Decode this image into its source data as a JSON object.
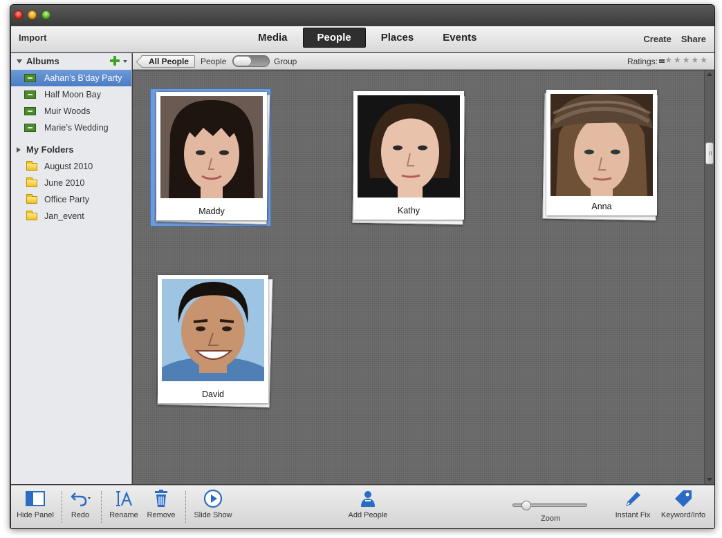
{
  "topbar": {
    "import_label": "Import",
    "tabs": [
      {
        "label": "Media",
        "active": false
      },
      {
        "label": "People",
        "active": true
      },
      {
        "label": "Places",
        "active": false
      },
      {
        "label": "Events",
        "active": false
      }
    ],
    "create_label": "Create",
    "share_label": "Share"
  },
  "sidebar": {
    "albums_heading": "Albums",
    "albums": [
      {
        "label": "Aahan’s B’day Party",
        "selected": true
      },
      {
        "label": "Half Moon Bay",
        "selected": false
      },
      {
        "label": "Muir Woods",
        "selected": false
      },
      {
        "label": "Marie’s Wedding",
        "selected": false
      }
    ],
    "folders_heading": "My Folders",
    "folders": [
      {
        "label": "August 2010"
      },
      {
        "label": "June 2010"
      },
      {
        "label": "Office Party"
      },
      {
        "label": "Jan_event"
      }
    ]
  },
  "filterbar": {
    "all_people_label": "All People",
    "people_label": "People",
    "group_label": "Group",
    "ratings_label": "Ratings:",
    "stars": "★★★★★"
  },
  "people": [
    {
      "name": "Maddy",
      "selected": true,
      "hair_color": "#1e1410",
      "skin_color": "#e3b8a0",
      "bg_color": "#6b5a52"
    },
    {
      "name": "Kathy",
      "selected": false,
      "hair_color": "#3a2618",
      "skin_color": "#e8c2ab",
      "bg_color": "#141414"
    },
    {
      "name": "Anna",
      "selected": false,
      "hair_color": "#6e5136",
      "skin_color": "#e2bba2",
      "bg_color": "#3d2a1e"
    },
    {
      "name": "David",
      "selected": false,
      "hair_color": "#17110d",
      "skin_color": "#c8946f",
      "bg_color": "#9ec4e4"
    }
  ],
  "bottombar": {
    "hide_panel_label": "Hide Panel",
    "redo_label": "Redo",
    "rename_label": "Rename",
    "remove_label": "Remove",
    "slideshow_label": "Slide Show",
    "add_people_label": "Add People",
    "zoom_label": "Zoom",
    "instant_fix_label": "Instant Fix",
    "keyword_info_label": "Keyword/Info"
  },
  "colors": {
    "accent": "#2a6cc4",
    "selection": "#4b7cc6",
    "content_bg": "#6e6e6e"
  }
}
